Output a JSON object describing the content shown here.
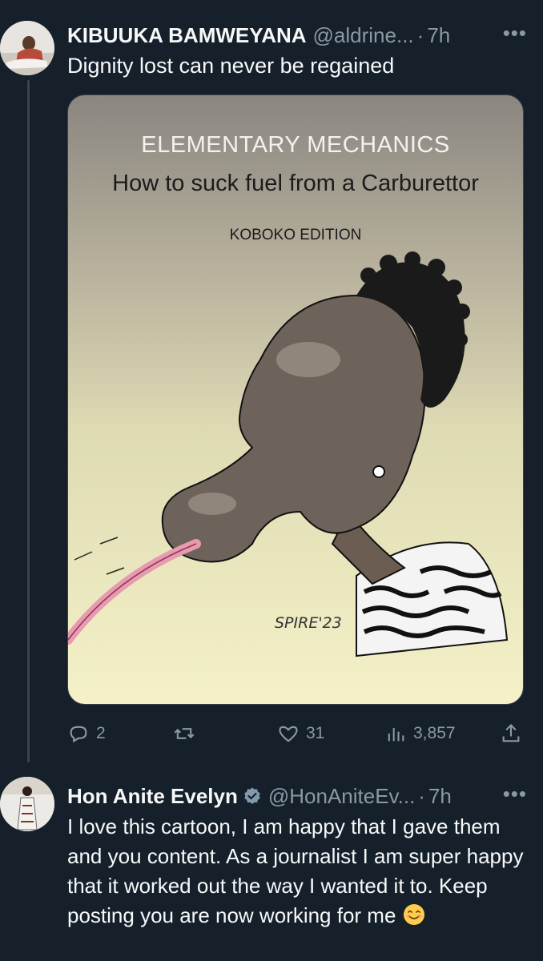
{
  "tweets": [
    {
      "author": {
        "name": "KIBUUKA BAMWEYANA",
        "handle": "@aldrine...",
        "verified": false
      },
      "time": "7h",
      "text": "Dignity lost can never be regained",
      "media": {
        "title_line1": "ELEMENTARY MECHANICS",
        "title_line2": "How to suck fuel from a Carburettor",
        "edition": "KOBOKO EDITION",
        "signature": "SPIRE'23"
      },
      "stats": {
        "replies": "2",
        "retweets": "",
        "likes": "31",
        "views": "3,857"
      }
    },
    {
      "author": {
        "name": "Hon Anite Evelyn",
        "handle": "@HonAniteEv...",
        "verified": true
      },
      "time": "7h",
      "text": "I love this cartoon, I am happy that I gave them and you content. As a journalist I am super happy that it worked out the way I wanted it to. Keep posting you are now working for me",
      "emoji": "smiling-face-icon"
    }
  ],
  "ui": {
    "dot": "·",
    "more": "•••"
  },
  "colors": {
    "background": "#15202b",
    "text_primary": "#f7f9f9",
    "text_secondary": "#8b98a5",
    "verified_blue": "#1d9bf0"
  }
}
